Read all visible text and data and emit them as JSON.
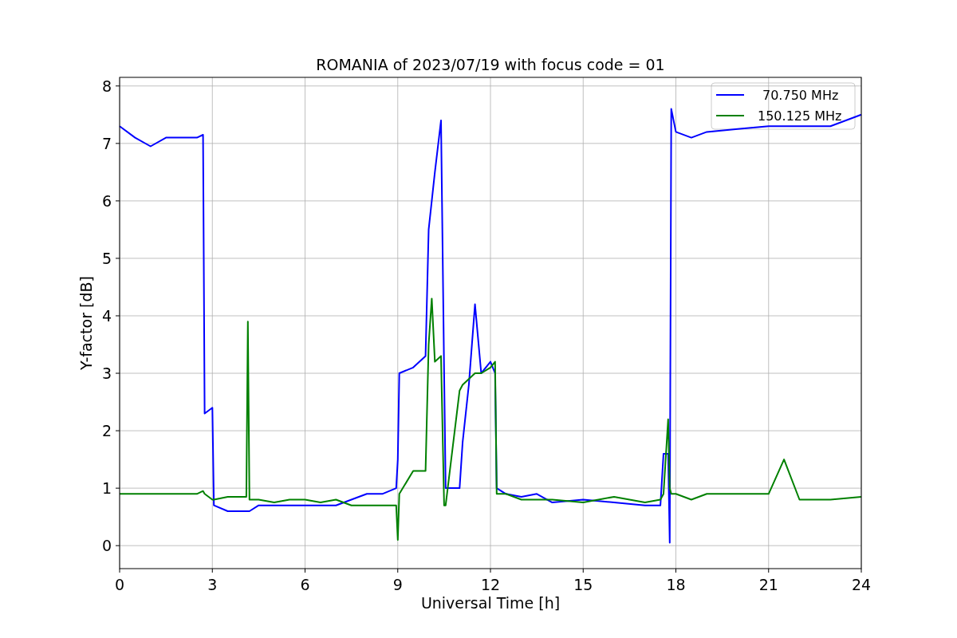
{
  "chart_data": {
    "type": "line",
    "title": "ROMANIA of 2023/07/19 with focus code = 01",
    "xlabel": "Universal Time [h]",
    "ylabel": "Y-factor [dB]",
    "x": [
      0,
      0.5,
      1,
      1.5,
      2,
      2.5,
      2.7,
      2.75,
      3,
      3.05,
      3.5,
      4,
      4.1,
      4.15,
      4.2,
      4.5,
      5,
      5.5,
      6,
      6.5,
      7,
      7.5,
      8,
      8.5,
      8.95,
      9,
      9.05,
      9.5,
      9.9,
      10,
      10.1,
      10.2,
      10.4,
      10.5,
      10.55,
      11,
      11.1,
      11.3,
      11.5,
      11.7,
      12,
      12.15,
      12.2,
      12.5,
      13,
      13.5,
      14,
      15,
      16,
      17,
      17.5,
      17.6,
      17.75,
      17.8,
      17.85,
      18,
      18.5,
      19,
      20,
      21,
      21.5,
      22,
      23,
      24
    ],
    "series": [
      {
        "name": "70.750 MHz",
        "color": "#0000ff",
        "values": [
          7.3,
          7.1,
          6.95,
          7.1,
          7.1,
          7.1,
          7.15,
          2.3,
          2.4,
          0.7,
          0.6,
          0.6,
          0.6,
          0.6,
          0.6,
          0.7,
          0.7,
          0.7,
          0.7,
          0.7,
          0.7,
          0.8,
          0.9,
          0.9,
          1.0,
          1.5,
          3.0,
          3.1,
          3.3,
          5.5,
          6.0,
          6.5,
          7.4,
          3.0,
          1.0,
          1.0,
          1.8,
          2.8,
          4.2,
          3.0,
          3.2,
          3.0,
          1.0,
          0.9,
          0.85,
          0.9,
          0.75,
          0.8,
          0.75,
          0.7,
          0.7,
          1.6,
          1.6,
          0.05,
          7.6,
          7.2,
          7.1,
          7.2,
          7.25,
          7.3,
          7.3,
          7.3,
          7.3,
          7.5
        ]
      },
      {
        "name": "150.125 MHz",
        "color": "#008000",
        "values": [
          0.9,
          0.9,
          0.9,
          0.9,
          0.9,
          0.9,
          0.95,
          0.9,
          0.8,
          0.8,
          0.85,
          0.85,
          0.85,
          3.9,
          0.8,
          0.8,
          0.75,
          0.8,
          0.8,
          0.75,
          0.8,
          0.7,
          0.7,
          0.7,
          0.7,
          0.1,
          0.9,
          1.3,
          1.3,
          3.5,
          4.3,
          3.2,
          3.3,
          0.7,
          0.7,
          2.7,
          2.8,
          2.9,
          3.0,
          3.0,
          3.1,
          3.2,
          0.9,
          0.9,
          0.8,
          0.8,
          0.8,
          0.75,
          0.85,
          0.75,
          0.8,
          0.9,
          2.2,
          1.0,
          0.9,
          0.9,
          0.8,
          0.9,
          0.9,
          0.9,
          1.5,
          0.8,
          0.8,
          0.85
        ]
      }
    ],
    "xlim": [
      0,
      24
    ],
    "ylim": [
      -0.4,
      8.15
    ],
    "xticks": [
      0,
      3,
      6,
      9,
      12,
      15,
      18,
      21,
      24
    ],
    "yticks": [
      0,
      1,
      2,
      3,
      4,
      5,
      6,
      7,
      8
    ],
    "grid": true,
    "legend": true
  }
}
